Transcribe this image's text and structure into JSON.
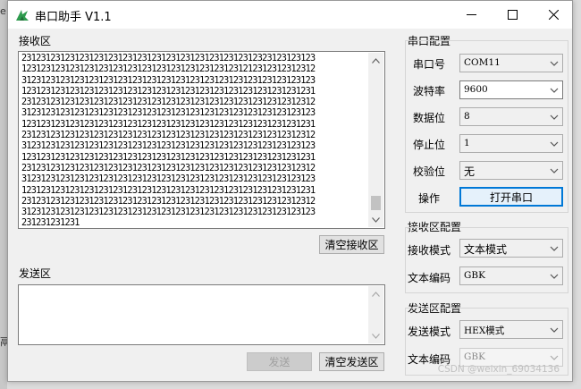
{
  "window": {
    "title": "串口助手 V1.1",
    "minimize_glyph": "minimize-icon",
    "maximize_glyph": "maximize-icon",
    "close_glyph": "close-icon"
  },
  "background": {
    "letter_top": "e",
    "letter_bottom": "鬲"
  },
  "receive_area": {
    "title": "接收区",
    "lines": [
      "2312312312312312312312312312312312312312312312312323123123123",
      "1231231231231231231231231231231231231231231231212312312312312",
      "3123123123123123123123123123123123123123123123123123123123123",
      "1231231231231231231231231231231231231231231231231231231231231",
      "2312312312312312312312312312312312312312312312312312312312312",
      "3123123123123123123123123123123123123123123123123123123123123",
      "1231231231231231231231231231231231231231231231231231231231231",
      "2312312312312312312312312312312312312312312312312312312312312",
      "3123123123123123123123123123123123123123123123123123123123123",
      "1231231231231231231231231231231231231231231231231231231231231",
      "2312312312312312312312312312312312312312312312312312312312312",
      "3123123123123123123123123123123123123123123123123123123123123",
      "1231231231231231231231231231231231231231231231231231231231231",
      "2312312312312312312312312312312312312312312312312312312312312",
      "3123123123123123123123123123123123123123123123123123123123123",
      "231231231231"
    ],
    "clear_label": "清空接收区"
  },
  "send_area": {
    "title": "发送区",
    "value": "",
    "send_label": "发送",
    "clear_label": "清空发送区"
  },
  "serial_config": {
    "title": "串口配置",
    "port_label": "串口号",
    "port_value": "COM11",
    "baud_label": "波特率",
    "baud_value": "9600",
    "databits_label": "数据位",
    "databits_value": "8",
    "stopbits_label": "停止位",
    "stopbits_value": "1",
    "parity_label": "校验位",
    "parity_value": "无",
    "action_label": "操作",
    "open_label": "打开串口"
  },
  "receive_config": {
    "title": "接收区配置",
    "mode_label": "接收模式",
    "mode_value": "文本模式",
    "encoding_label": "文本编码",
    "encoding_value": "GBK"
  },
  "send_config": {
    "title": "发送区配置",
    "mode_label": "发送模式",
    "mode_value": "HEX模式",
    "encoding_label": "文本编码",
    "encoding_value": "GBK"
  },
  "watermark": "CSDN @weixin_69034136"
}
